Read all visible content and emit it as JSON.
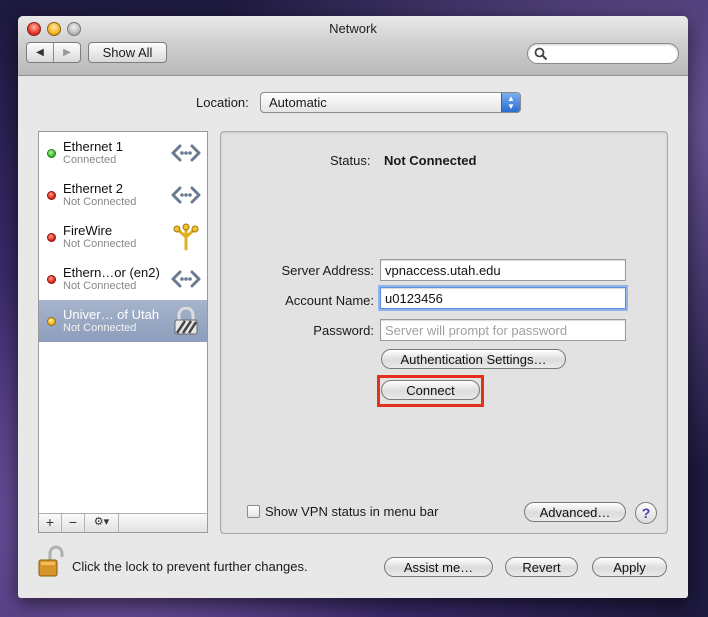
{
  "window": {
    "title": "Network"
  },
  "toolbar": {
    "show_all_label": "Show All",
    "search_placeholder": ""
  },
  "location": {
    "label": "Location:",
    "value": "Automatic"
  },
  "services": [
    {
      "name": "Ethernet 1",
      "status": "Connected",
      "dot": "green",
      "icon": "ethernet-icon"
    },
    {
      "name": "Ethernet 2",
      "status": "Not Connected",
      "dot": "red",
      "icon": "ethernet-icon"
    },
    {
      "name": "FireWire",
      "status": "Not Connected",
      "dot": "red",
      "icon": "firewire-icon"
    },
    {
      "name": "Ethern…or (en2)",
      "status": "Not Connected",
      "dot": "red",
      "icon": "ethernet-icon"
    },
    {
      "name": "Univer… of Utah",
      "status": "Not Connected",
      "dot": "yellow",
      "icon": "vpn-lock-icon",
      "selected": true
    }
  ],
  "list_toolbar": {
    "add": "+",
    "remove": "−",
    "action": "⚙▾"
  },
  "detail": {
    "status_label": "Status:",
    "status_value": "Not Connected",
    "server_address_label": "Server Address:",
    "server_address_value": "vpnaccess.utah.edu",
    "account_name_label": "Account Name:",
    "account_name_value": "u0123456",
    "password_label": "Password:",
    "password_placeholder": "Server will prompt for password",
    "auth_settings_label": "Authentication Settings…",
    "connect_label": "Connect",
    "show_vpn_status_label": "Show VPN status in menu bar",
    "advanced_label": "Advanced…",
    "help_label": "?"
  },
  "footer": {
    "lock_text": "Click the lock to prevent further changes.",
    "assist_label": "Assist me…",
    "revert_label": "Revert",
    "apply_label": "Apply"
  },
  "colors": {
    "highlight": "#e6301e",
    "selection": "#8d9dbb",
    "accent_blue": "#2a6dd0"
  }
}
